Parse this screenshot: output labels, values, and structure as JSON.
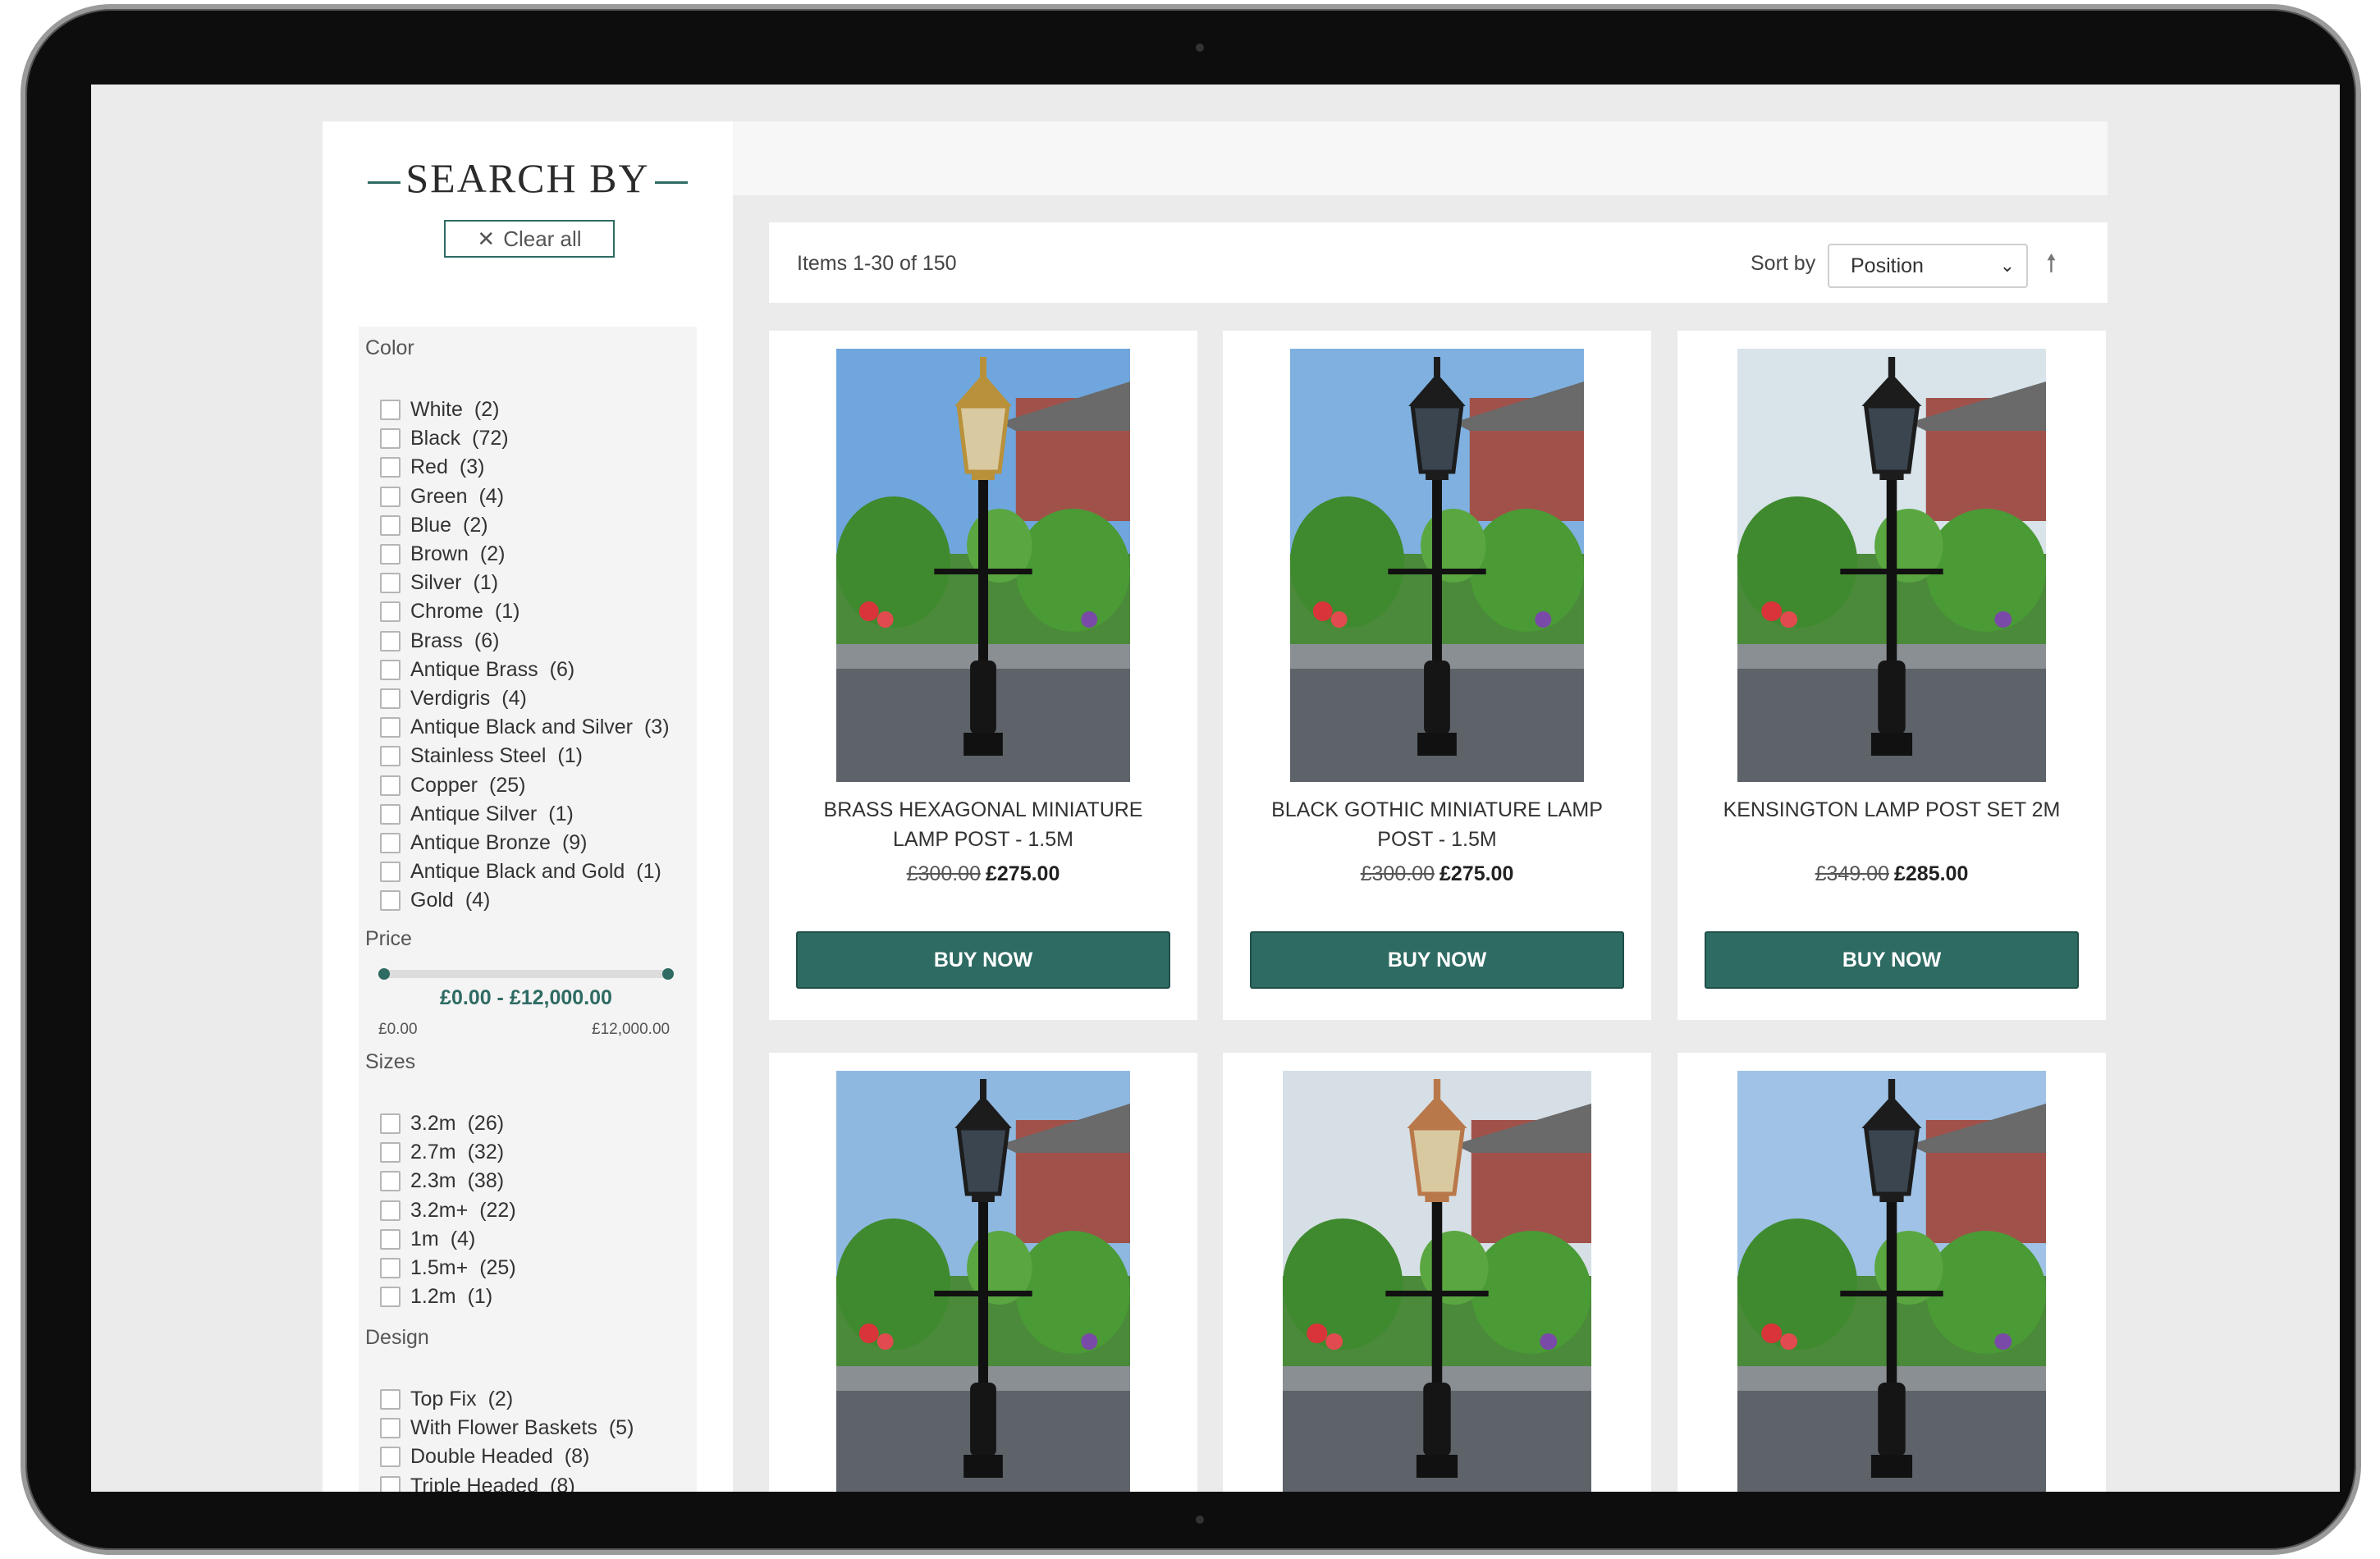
{
  "sidebar": {
    "title": "SEARCH BY",
    "clear_all": "Clear all",
    "color": {
      "heading": "Color",
      "items": [
        {
          "label": "White",
          "count": "(2)"
        },
        {
          "label": "Black",
          "count": "(72)"
        },
        {
          "label": "Red",
          "count": "(3)"
        },
        {
          "label": "Green",
          "count": "(4)"
        },
        {
          "label": "Blue",
          "count": "(2)"
        },
        {
          "label": "Brown",
          "count": "(2)"
        },
        {
          "label": "Silver",
          "count": "(1)"
        },
        {
          "label": "Chrome",
          "count": "(1)"
        },
        {
          "label": "Brass",
          "count": "(6)"
        },
        {
          "label": "Antique Brass",
          "count": "(6)"
        },
        {
          "label": "Verdigris",
          "count": "(4)"
        },
        {
          "label": "Antique Black and Silver",
          "count": "(3)"
        },
        {
          "label": "Stainless Steel",
          "count": "(1)"
        },
        {
          "label": "Copper",
          "count": "(25)"
        },
        {
          "label": "Antique Silver",
          "count": "(1)"
        },
        {
          "label": "Antique Bronze",
          "count": "(9)"
        },
        {
          "label": "Antique Black and Gold",
          "count": "(1)"
        },
        {
          "label": "Gold",
          "count": "(4)"
        }
      ]
    },
    "price": {
      "heading": "Price",
      "range": "£0.00 - £12,000.00",
      "min": "£0.00",
      "max": "£12,000.00",
      "selected_min_fraction": 0,
      "selected_max_fraction": 1
    },
    "sizes": {
      "heading": "Sizes",
      "items": [
        {
          "label": "3.2m",
          "count": "(26)"
        },
        {
          "label": "2.7m",
          "count": "(32)"
        },
        {
          "label": "2.3m",
          "count": "(38)"
        },
        {
          "label": "3.2m+",
          "count": "(22)"
        },
        {
          "label": "1m",
          "count": "(4)"
        },
        {
          "label": "1.5m+",
          "count": "(25)"
        },
        {
          "label": "1.2m",
          "count": "(1)"
        }
      ]
    },
    "design": {
      "heading": "Design",
      "items": [
        {
          "label": "Top Fix",
          "count": "(2)"
        },
        {
          "label": "With Flower Baskets",
          "count": "(5)"
        },
        {
          "label": "Double Headed",
          "count": "(8)"
        },
        {
          "label": "Triple Headed",
          "count": "(8)"
        }
      ]
    }
  },
  "toolbar": {
    "items_count": "Items 1-30 of 150",
    "sort_label": "Sort by",
    "sort_value": "Position",
    "sort_direction_icon": "arrow-up-icon"
  },
  "products": [
    {
      "title": "BRASS HEXAGONAL MINIATURE LAMP POST - 1.5M",
      "old_price": "£300.00",
      "price": "£275.00",
      "button": "BUY NOW",
      "lantern": "brass"
    },
    {
      "title": "BLACK GOTHIC MINIATURE LAMP POST - 1.5M",
      "old_price": "£300.00",
      "price": "£275.00",
      "button": "BUY NOW",
      "lantern": "black"
    },
    {
      "title": "KENSINGTON LAMP POST SET 2M",
      "old_price": "£349.00",
      "price": "£285.00",
      "button": "BUY NOW",
      "lantern": "black"
    },
    {
      "lantern": "black"
    },
    {
      "lantern": "copper"
    },
    {
      "lantern": "black"
    }
  ],
  "colors": {
    "accent": "#2e6b63",
    "page_bg": "#ebebeb"
  }
}
